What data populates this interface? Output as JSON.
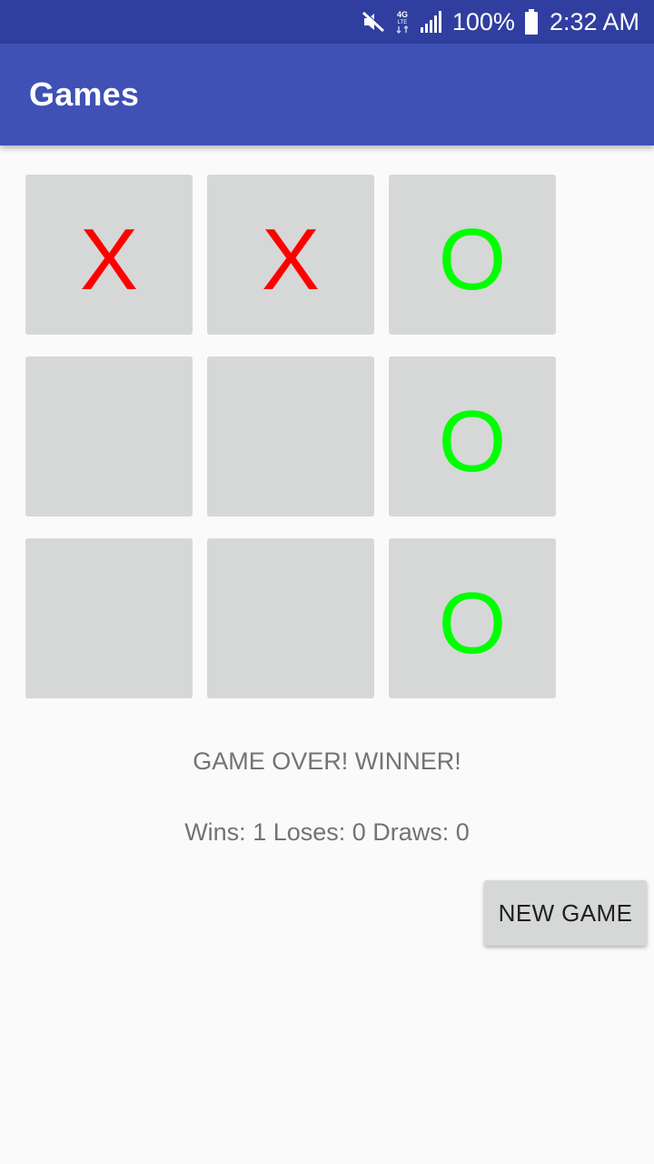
{
  "status_bar": {
    "icons": [
      "mute-icon",
      "4g-lte-icon",
      "signal-icon",
      "battery-icon"
    ],
    "battery": "100%",
    "time": "2:32 AM"
  },
  "app_bar": {
    "title": "Games",
    "color": "#3f51b5",
    "status_color": "#303f9f"
  },
  "board": {
    "cells": [
      {
        "mark": "X",
        "type": "x"
      },
      {
        "mark": "X",
        "type": "x"
      },
      {
        "mark": "O",
        "type": "o"
      },
      {
        "mark": "",
        "type": "empty"
      },
      {
        "mark": "",
        "type": "empty"
      },
      {
        "mark": "O",
        "type": "o"
      },
      {
        "mark": "",
        "type": "empty"
      },
      {
        "mark": "",
        "type": "empty"
      },
      {
        "mark": "O",
        "type": "o"
      }
    ],
    "colors": {
      "x": "#ff0000",
      "o": "#00ff00",
      "cell": "#d6d7d7"
    }
  },
  "game": {
    "status": "GAME OVER! WINNER!",
    "score": "Wins: 1 Loses: 0 Draws: 0",
    "new_game_label": "NEW GAME"
  }
}
